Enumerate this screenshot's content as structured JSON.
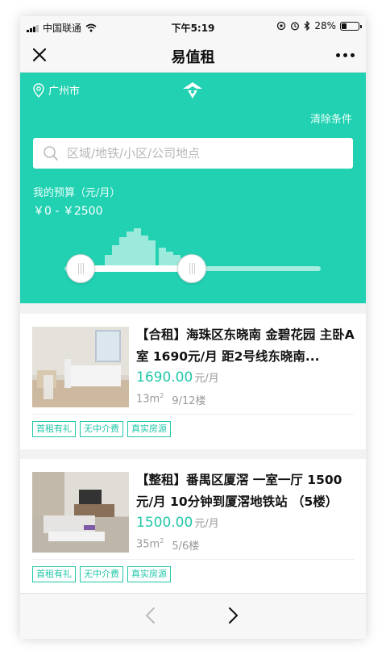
{
  "status_bar": {
    "carrier": "中国联通",
    "time": "下午5:19",
    "battery": "28%",
    "battery_level": 0.28
  },
  "nav": {
    "title": "易值租",
    "close_icon": "close-icon",
    "more_icon": "more-icon"
  },
  "filter": {
    "city": "广州市",
    "clear_label": "清除条件",
    "search_placeholder": "区域/地铁/小区/公司地点",
    "budget_label": "我的预算（元/月）",
    "budget_value": "￥0 - ￥2500",
    "accent_color": "#22d1b2"
  },
  "listings": [
    {
      "title": "【合租】海珠区东晓南 金碧花园 主卧A室 1690元/月 距2号线东晓南...",
      "price": "1690.00",
      "price_unit": "元/月",
      "area": "13m",
      "area_sup": "2",
      "floor": "9/12楼",
      "tags": [
        "首租有礼",
        "无中介费",
        "真实房源"
      ]
    },
    {
      "title": "【整租】番禺区厦滘 一室一厅 1500元/月 10分钟到厦滘地铁站 （5楼）",
      "price": "1500.00",
      "price_unit": "元/月",
      "area": "35m",
      "area_sup": "2",
      "floor": "5/6楼",
      "tags": [
        "首租有礼",
        "无中介费",
        "真实房源"
      ]
    }
  ],
  "toolbar": {
    "back_icon": "chevron-left-icon",
    "forward_icon": "chevron-right-icon"
  }
}
